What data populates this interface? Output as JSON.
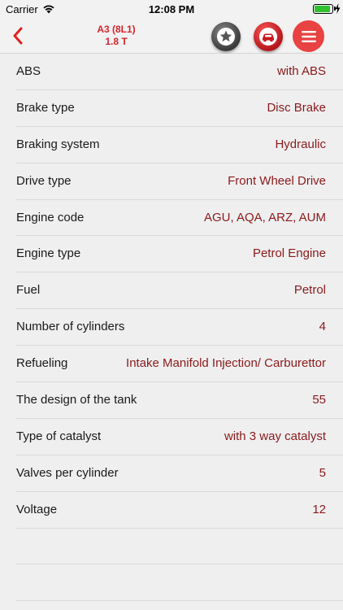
{
  "status_bar": {
    "carrier": "Carrier",
    "time": "12:08 PM",
    "battery_level": 0.9,
    "battery_color": "#2fc12f"
  },
  "nav": {
    "back_icon": "chevron-left-icon",
    "title_line1": "A3 (8L1)",
    "title_line2": "1.8 T",
    "title_color": "#d8232a",
    "buttons": [
      {
        "name": "favorite",
        "icon": "star-icon"
      },
      {
        "name": "vehicle",
        "icon": "car-icon"
      },
      {
        "name": "menu",
        "icon": "hamburger-menu-icon"
      }
    ]
  },
  "specs": [
    {
      "label": "ABS",
      "value": "with ABS"
    },
    {
      "label": "Brake type",
      "value": "Disc Brake"
    },
    {
      "label": "Braking system",
      "value": "Hydraulic"
    },
    {
      "label": "Drive type",
      "value": "Front Wheel Drive"
    },
    {
      "label": "Engine code",
      "value": "AGU, AQA, ARZ, AUM"
    },
    {
      "label": "Engine type",
      "value": "Petrol Engine"
    },
    {
      "label": "Fuel",
      "value": "Petrol"
    },
    {
      "label": "Number of cylinders",
      "value": "4"
    },
    {
      "label": "Refueling",
      "value": "Intake Manifold Injection/ Carburettor"
    },
    {
      "label": "The design of the tank",
      "value": "55"
    },
    {
      "label": "Type of catalyst",
      "value": "with 3 way catalyst"
    },
    {
      "label": "Valves per cylinder",
      "value": "5"
    },
    {
      "label": "Voltage",
      "value": "12"
    }
  ],
  "colors": {
    "value_text": "#8b1a1a",
    "accent": "#e94242"
  }
}
